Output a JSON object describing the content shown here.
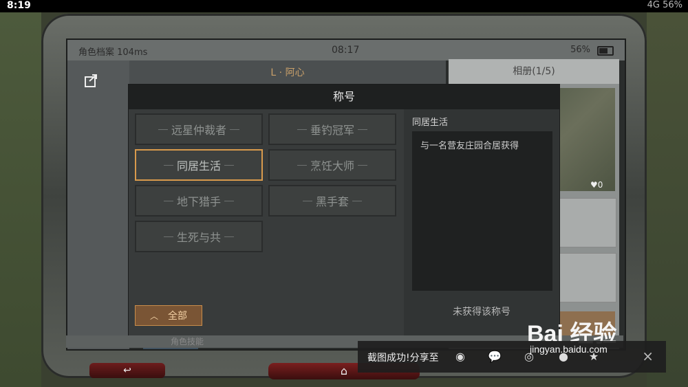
{
  "phone_status": {
    "time": "8:19",
    "right": "4G  56%"
  },
  "game_status": {
    "left": "角色档案  104ms",
    "time": "08:17",
    "battery": "56%"
  },
  "tabs": {
    "character_name": "L · 阿心",
    "album": "相册(1/5)"
  },
  "photo_likes": "♥0",
  "modal": {
    "title": "称号",
    "items": [
      {
        "label": "远星仲裁者",
        "selected": false
      },
      {
        "label": "垂钓冠军",
        "selected": false
      },
      {
        "label": "同居生活",
        "selected": true
      },
      {
        "label": "烹饪大师",
        "selected": false
      },
      {
        "label": "地下猎手",
        "selected": false
      },
      {
        "label": "黑手套",
        "selected": false
      },
      {
        "label": "生死与共",
        "selected": false
      }
    ],
    "filter_button": "全部",
    "detail": {
      "title": "同居生活",
      "description": "与一名营友庄园合居获得",
      "status": "未获得该称号"
    }
  },
  "bottom_label": "角色技能",
  "toast": {
    "message": "截图成功!分享至",
    "close": "×"
  },
  "watermark": {
    "brand": "Bai 经验",
    "url": "jingyan.baidu.com"
  },
  "colors": {
    "selected_border": "#d99a4c",
    "filter_button_bg": "#7a5535",
    "accent_tab_text": "#c9a06a"
  }
}
